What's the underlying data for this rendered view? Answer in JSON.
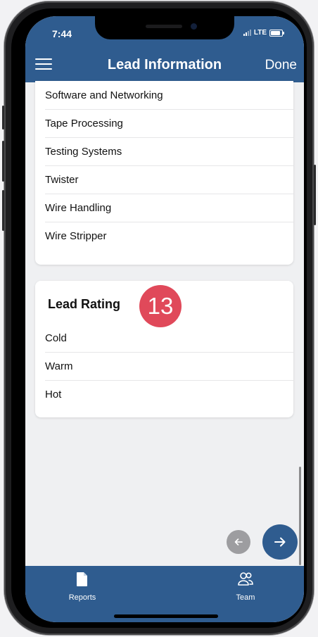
{
  "status_bar": {
    "time": "7:44",
    "network": "LTE"
  },
  "header": {
    "title": "Lead Information",
    "done_label": "Done"
  },
  "product_list": {
    "items": [
      {
        "label": "Software and Networking"
      },
      {
        "label": "Tape Processing"
      },
      {
        "label": "Testing Systems"
      },
      {
        "label": "Twister"
      },
      {
        "label": "Wire Handling"
      },
      {
        "label": "Wire Stripper"
      }
    ]
  },
  "lead_rating": {
    "title": "Lead Rating",
    "badge": "13",
    "options": [
      {
        "label": "Cold"
      },
      {
        "label": "Warm"
      },
      {
        "label": "Hot"
      }
    ]
  },
  "navigation": {
    "prev_icon": "arrow-left-icon",
    "next_icon": "arrow-right-icon"
  },
  "tabbar": {
    "tabs": [
      {
        "label": "Reports",
        "icon": "document-icon"
      },
      {
        "label": "Team",
        "icon": "people-icon"
      }
    ]
  },
  "colors": {
    "primary": "#2f5c8f",
    "badge": "#e0495a",
    "background": "#eff0f2",
    "card": "#ffffff"
  }
}
